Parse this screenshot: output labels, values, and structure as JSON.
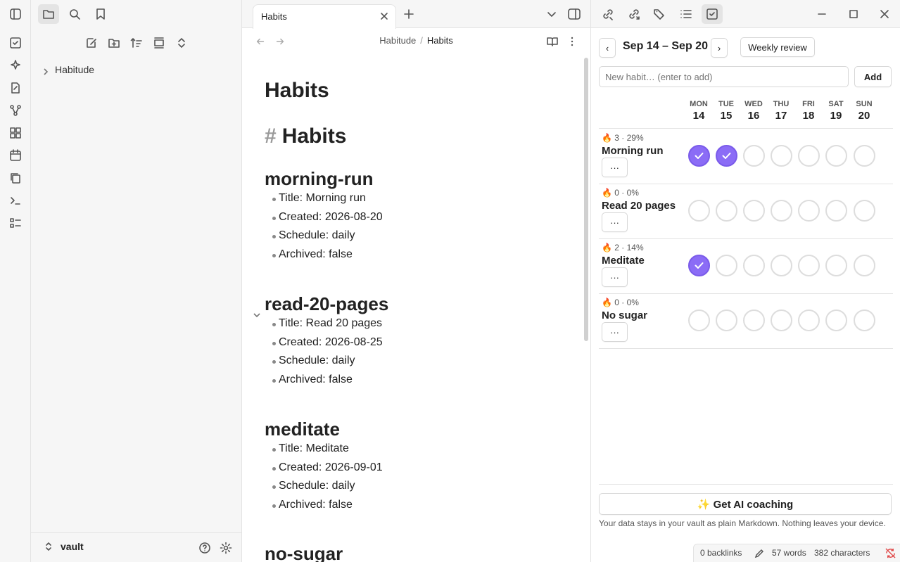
{
  "sidebar": {
    "tree_items": [
      {
        "label": "Habitude"
      }
    ],
    "vault_name": "vault"
  },
  "editor": {
    "tab_title": "Habits",
    "breadcrumb": {
      "folder": "Habitude",
      "separator": "/",
      "current": "Habits"
    },
    "page_title": "Habits",
    "heading_hash": "#",
    "heading": "Habits",
    "sections": [
      {
        "title": "morning-run",
        "items": [
          "Title: Morning run",
          "Created: 2026-08-20",
          "Schedule: daily",
          "Archived: false"
        ]
      },
      {
        "title": "read-20-pages",
        "items": [
          "Title: Read 20 pages",
          "Created: 2026-08-25",
          "Schedule: daily",
          "Archived: false"
        ]
      },
      {
        "title": "meditate",
        "items": [
          "Title: Meditate",
          "Created: 2026-09-01",
          "Schedule: daily",
          "Archived: false"
        ]
      },
      {
        "title": "no-sugar",
        "items": []
      }
    ]
  },
  "habits_panel": {
    "prev_label": "‹",
    "next_label": "›",
    "week_range": "Sep 14 – Sep 20",
    "weekly_review_label": "Weekly review",
    "new_habit_placeholder": "New habit… (enter to add)",
    "add_label": "Add",
    "days": [
      {
        "name": "MON",
        "date": "14"
      },
      {
        "name": "TUE",
        "date": "15"
      },
      {
        "name": "WED",
        "date": "16"
      },
      {
        "name": "THU",
        "date": "17"
      },
      {
        "name": "FRI",
        "date": "18"
      },
      {
        "name": "SAT",
        "date": "19"
      },
      {
        "name": "SUN",
        "date": "20"
      }
    ],
    "habits": [
      {
        "meta": "🔥 3 · 29%",
        "name": "Morning run",
        "more_label": "···",
        "done": [
          true,
          true,
          false,
          false,
          false,
          false,
          false
        ]
      },
      {
        "meta": "🔥 0 · 0%",
        "name": "Read 20 pages",
        "more_label": "···",
        "done": [
          false,
          false,
          false,
          false,
          false,
          false,
          false
        ]
      },
      {
        "meta": "🔥 2 · 14%",
        "name": "Meditate",
        "more_label": "···",
        "done": [
          true,
          false,
          false,
          false,
          false,
          false,
          false
        ]
      },
      {
        "meta": "🔥 0 · 0%",
        "name": "No sugar",
        "more_label": "···",
        "done": [
          false,
          false,
          false,
          false,
          false,
          false,
          false
        ]
      }
    ],
    "ai_coaching_label": "✨ Get AI coaching",
    "privacy_note": "Your data stays in your vault as plain Markdown. Nothing leaves your device.",
    "accent_color": "#8b6cf6"
  },
  "statusbar": {
    "backlinks": "0 backlinks",
    "words": "57 words",
    "characters": "382 characters"
  }
}
